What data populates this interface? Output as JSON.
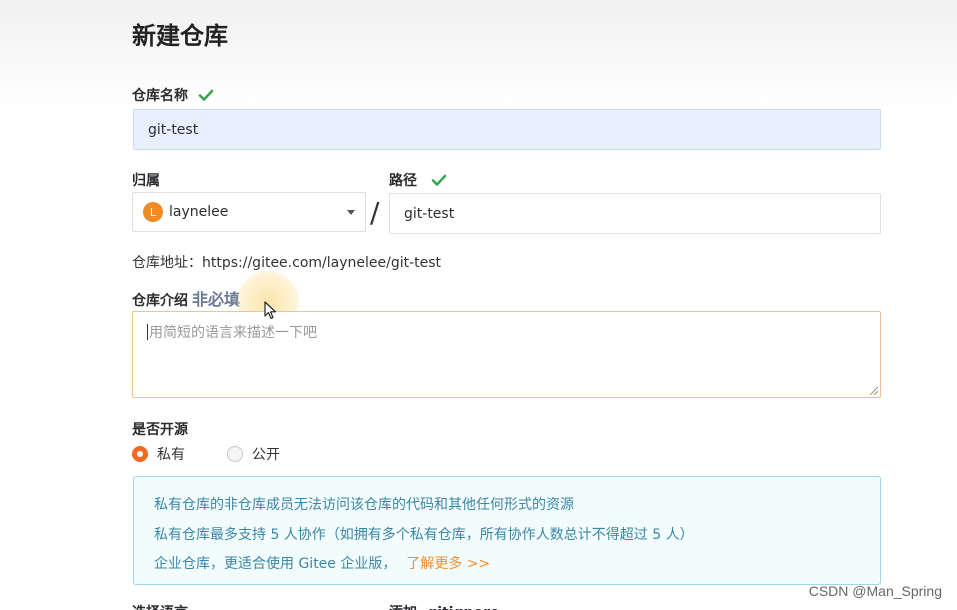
{
  "page": {
    "title": "新建仓库"
  },
  "repo_name": {
    "label": "仓库名称",
    "value": "git-test"
  },
  "owner": {
    "label": "归属",
    "avatar_letter": "L",
    "value": "laynelee"
  },
  "separator": "/",
  "path": {
    "label": "路径",
    "value": "git-test"
  },
  "address": {
    "label": "仓库地址：",
    "value": "https://gitee.com/laynelee/git-test"
  },
  "description": {
    "label": "仓库介绍",
    "optional": "非必填",
    "placeholder": "用简短的语言来描述一下吧"
  },
  "visibility": {
    "label": "是否开源",
    "options": [
      {
        "label": "私有",
        "selected": true
      },
      {
        "label": "公开",
        "selected": false
      }
    ]
  },
  "info": {
    "lines": [
      "私有仓库的非仓库成员无法访问该仓库的代码和其他任何形式的资源",
      "私有仓库最多支持 5 人协作（如拥有多个私有仓库，所有协作人数总计不得超过 5 人）",
      "企业仓库，更适合使用 Gitee 企业版，"
    ],
    "link": "了解更多 >>"
  },
  "bottom_labels": [
    "选择语言",
    "添加 .gitignore"
  ],
  "watermark": "CSDN @Man_Spring",
  "colors": {
    "accent": "#f06b1f",
    "check": "#3aa551",
    "info_text": "#3a86a8",
    "link": "#ef8f2f"
  }
}
